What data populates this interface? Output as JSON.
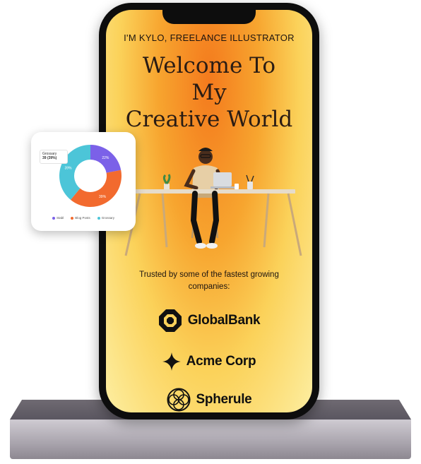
{
  "hero": {
    "intro": "I'M KYLO, FREELANCE ILLUSTRATOR",
    "headline_lines": [
      "Welcome To",
      "My",
      "Creative World"
    ]
  },
  "trusted": {
    "text": "Trusted by some of the fastest growing companies:"
  },
  "companies": [
    {
      "name": "GlobalBank",
      "icon": "octagon-ring-icon"
    },
    {
      "name": "Acme Corp",
      "icon": "four-point-star-icon"
    },
    {
      "name": "Spherule",
      "icon": "sphere-circles-icon"
    }
  ],
  "colors": {
    "gradient_core": "#f47a1d",
    "gradient_edge": "#fdeea1",
    "text_dark": "#1c1410"
  },
  "chart_data": {
    "type": "pie",
    "donut": true,
    "categories": [
      "Stabl",
      "Blog Posts",
      "Grossary"
    ],
    "values": [
      22,
      39,
      39
    ],
    "slice_labels": [
      "22%",
      "39%",
      "39%"
    ],
    "colors": [
      "#7b61e8",
      "#f26a2e",
      "#4cc5d8"
    ],
    "tooltip": {
      "title": "Grossary",
      "value": "39 (39%)"
    },
    "legend_position": "bottom"
  }
}
